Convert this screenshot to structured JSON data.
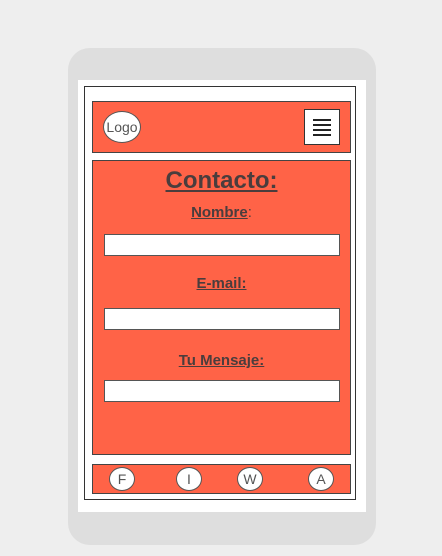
{
  "header": {
    "logo_text": "Logo",
    "menu_icon": "hamburger-menu-icon"
  },
  "main": {
    "title": "Contacto:",
    "name_label": "Nombre",
    "name_colon": ":",
    "email_label": "E-mail:",
    "message_label": "Tu Mensaje:",
    "name_value": "",
    "email_value": "",
    "message_value": ""
  },
  "footer": {
    "social": [
      {
        "letter": "F"
      },
      {
        "letter": "I"
      },
      {
        "letter": "W"
      },
      {
        "letter": "A"
      }
    ]
  },
  "colors": {
    "accent": "#ff6347",
    "text": "#4a3d3d",
    "device": "#dedede",
    "background": "#eeeeee"
  }
}
